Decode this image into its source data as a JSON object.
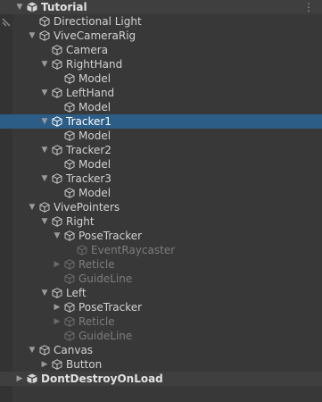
{
  "hierarchy": {
    "rows": [
      {
        "label": "Tutorial",
        "kind": "scene",
        "indent": 0,
        "arrow": "down"
      },
      {
        "label": "Directional Light",
        "kind": "object",
        "indent": 1,
        "arrow": "none"
      },
      {
        "label": "ViveCameraRig",
        "kind": "object",
        "indent": 1,
        "arrow": "down"
      },
      {
        "label": "Camera",
        "kind": "object",
        "indent": 2,
        "arrow": "none"
      },
      {
        "label": "RightHand",
        "kind": "object",
        "indent": 2,
        "arrow": "down"
      },
      {
        "label": "Model",
        "kind": "object",
        "indent": 3,
        "arrow": "none"
      },
      {
        "label": "LeftHand",
        "kind": "object",
        "indent": 2,
        "arrow": "down"
      },
      {
        "label": "Model",
        "kind": "object",
        "indent": 3,
        "arrow": "none"
      },
      {
        "label": "Tracker1",
        "kind": "object",
        "indent": 2,
        "arrow": "down",
        "selected": true
      },
      {
        "label": "Model",
        "kind": "object",
        "indent": 3,
        "arrow": "none"
      },
      {
        "label": "Tracker2",
        "kind": "object",
        "indent": 2,
        "arrow": "down"
      },
      {
        "label": "Model",
        "kind": "object",
        "indent": 3,
        "arrow": "none"
      },
      {
        "label": "Tracker3",
        "kind": "object",
        "indent": 2,
        "arrow": "down"
      },
      {
        "label": "Model",
        "kind": "object",
        "indent": 3,
        "arrow": "none"
      },
      {
        "label": "VivePointers",
        "kind": "object",
        "indent": 1,
        "arrow": "down"
      },
      {
        "label": "Right",
        "kind": "object",
        "indent": 2,
        "arrow": "down"
      },
      {
        "label": "PoseTracker",
        "kind": "object",
        "indent": 3,
        "arrow": "down"
      },
      {
        "label": "EventRaycaster",
        "kind": "object",
        "indent": 4,
        "arrow": "none",
        "inactive": true
      },
      {
        "label": "Reticle",
        "kind": "object",
        "indent": 3,
        "arrow": "right",
        "inactive": true
      },
      {
        "label": "GuideLine",
        "kind": "object",
        "indent": 3,
        "arrow": "none",
        "inactive": true
      },
      {
        "label": "Left",
        "kind": "object",
        "indent": 2,
        "arrow": "down"
      },
      {
        "label": "PoseTracker",
        "kind": "object",
        "indent": 3,
        "arrow": "right"
      },
      {
        "label": "Reticle",
        "kind": "object",
        "indent": 3,
        "arrow": "right",
        "inactive": true
      },
      {
        "label": "GuideLine",
        "kind": "object",
        "indent": 3,
        "arrow": "none",
        "inactive": true
      },
      {
        "label": "Canvas",
        "kind": "object",
        "indent": 1,
        "arrow": "down"
      },
      {
        "label": "Button",
        "kind": "object",
        "indent": 2,
        "arrow": "right"
      },
      {
        "label": "DontDestroyOnLoad",
        "kind": "scene-dim",
        "indent": 0,
        "arrow": "right"
      }
    ]
  },
  "colors": {
    "background": "#383838",
    "selected": "#2c5d87",
    "text": "#d2d2d2",
    "inactive_text": "#7d7d7d"
  },
  "icons": {
    "scene": "unity-scene-icon",
    "object": "gameobject-cube-icon",
    "expand": "chevron-down-icon",
    "collapse": "chevron-right-icon",
    "menu": "more-options-icon"
  }
}
